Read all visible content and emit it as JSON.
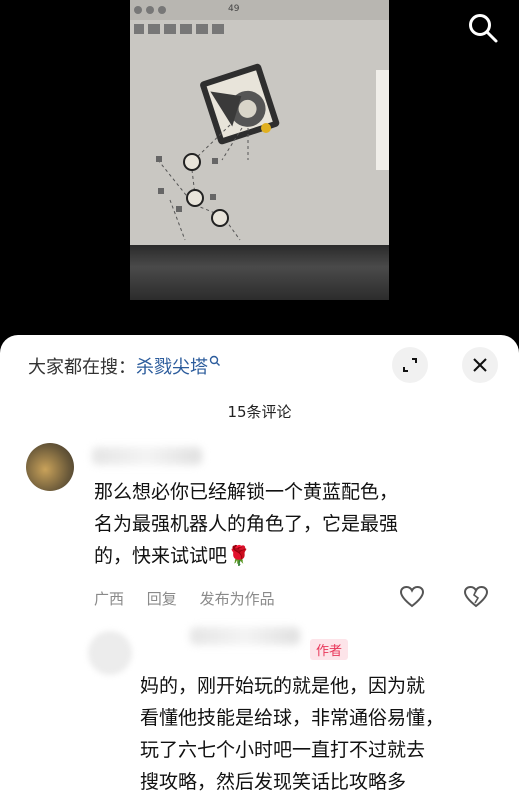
{
  "search_bar": {
    "prefix": "大家都在搜：",
    "query": "杀戮尖塔"
  },
  "comments_count": "15条评论",
  "comments": [
    {
      "text_lines": [
        "那么想必你已经解锁一个黄蓝配色，",
        "名为最强机器人的角色了，它是最强",
        "的，快来试试吧"
      ],
      "emoji": "🌹",
      "location": "广西",
      "reply_label": "回复",
      "post_label": "发布为作品"
    },
    {
      "author_tag": "作者",
      "text_lines": [
        "妈的，刚开始玩的就是他，因为就",
        "看懂他技能是给球，非常通俗易懂，",
        "玩了六七个小时吧一直打不过就去",
        "搜攻略，然后发现笑话比攻略多"
      ]
    }
  ],
  "video": {
    "status_number": "49"
  },
  "colors": {
    "link": "#2c5c9c",
    "author_tag": "#e8375a",
    "meta": "#8a8a8a"
  },
  "icons": [
    "search-icon",
    "expand-icon",
    "close-icon",
    "like-icon",
    "dislike-icon"
  ]
}
